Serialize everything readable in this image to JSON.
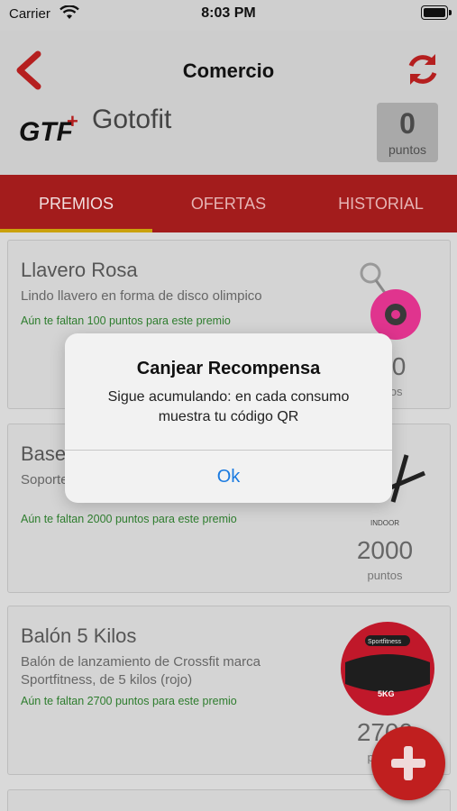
{
  "status": {
    "carrier": "Carrier",
    "time": "8:03 PM"
  },
  "header": {
    "title": "Comercio",
    "brand_name": "Gotofit",
    "logo_text": "GTF+",
    "points_value": "0",
    "points_label": "puntos"
  },
  "tabs": [
    {
      "label": "PREMIOS",
      "active": true
    },
    {
      "label": "OFERTAS",
      "active": false
    },
    {
      "label": "HISTORIAL",
      "active": false
    }
  ],
  "rewards": [
    {
      "title": "Llavero Rosa",
      "description": "Lindo llavero en forma de disco olimpico",
      "hint": "Aún te faltan 100 puntos para este premio",
      "points": "100",
      "points_label": "puntos",
      "icon": "keychain-image"
    },
    {
      "title": "Base",
      "description": "Soporte... olímpic...",
      "hint": "Aún te faltan 2000 puntos para este premio",
      "points": "2000",
      "points_label": "puntos",
      "icon": "plate-rack-image"
    },
    {
      "title": "Balón 5 Kilos",
      "description": "Balón de lanzamiento de Crossfit marca Sportfitness, de 5 kilos (rojo)",
      "hint": "Aún te faltan 2700 puntos para este premio",
      "points": "2700",
      "points_label": "puntos",
      "icon": "medicine-ball-image",
      "ball_brand": "Sportfitness",
      "ball_weight": "5KG"
    }
  ],
  "alert": {
    "title": "Canjear Recompensa",
    "message": "Sigue acumulando: en cada consumo muestra tu código QR",
    "button": "Ok"
  },
  "colors": {
    "accent": "#a31c1c",
    "tab_indicator": "#caa10c",
    "hint_green": "#2e7d2e",
    "link_blue": "#1a7ae0"
  }
}
